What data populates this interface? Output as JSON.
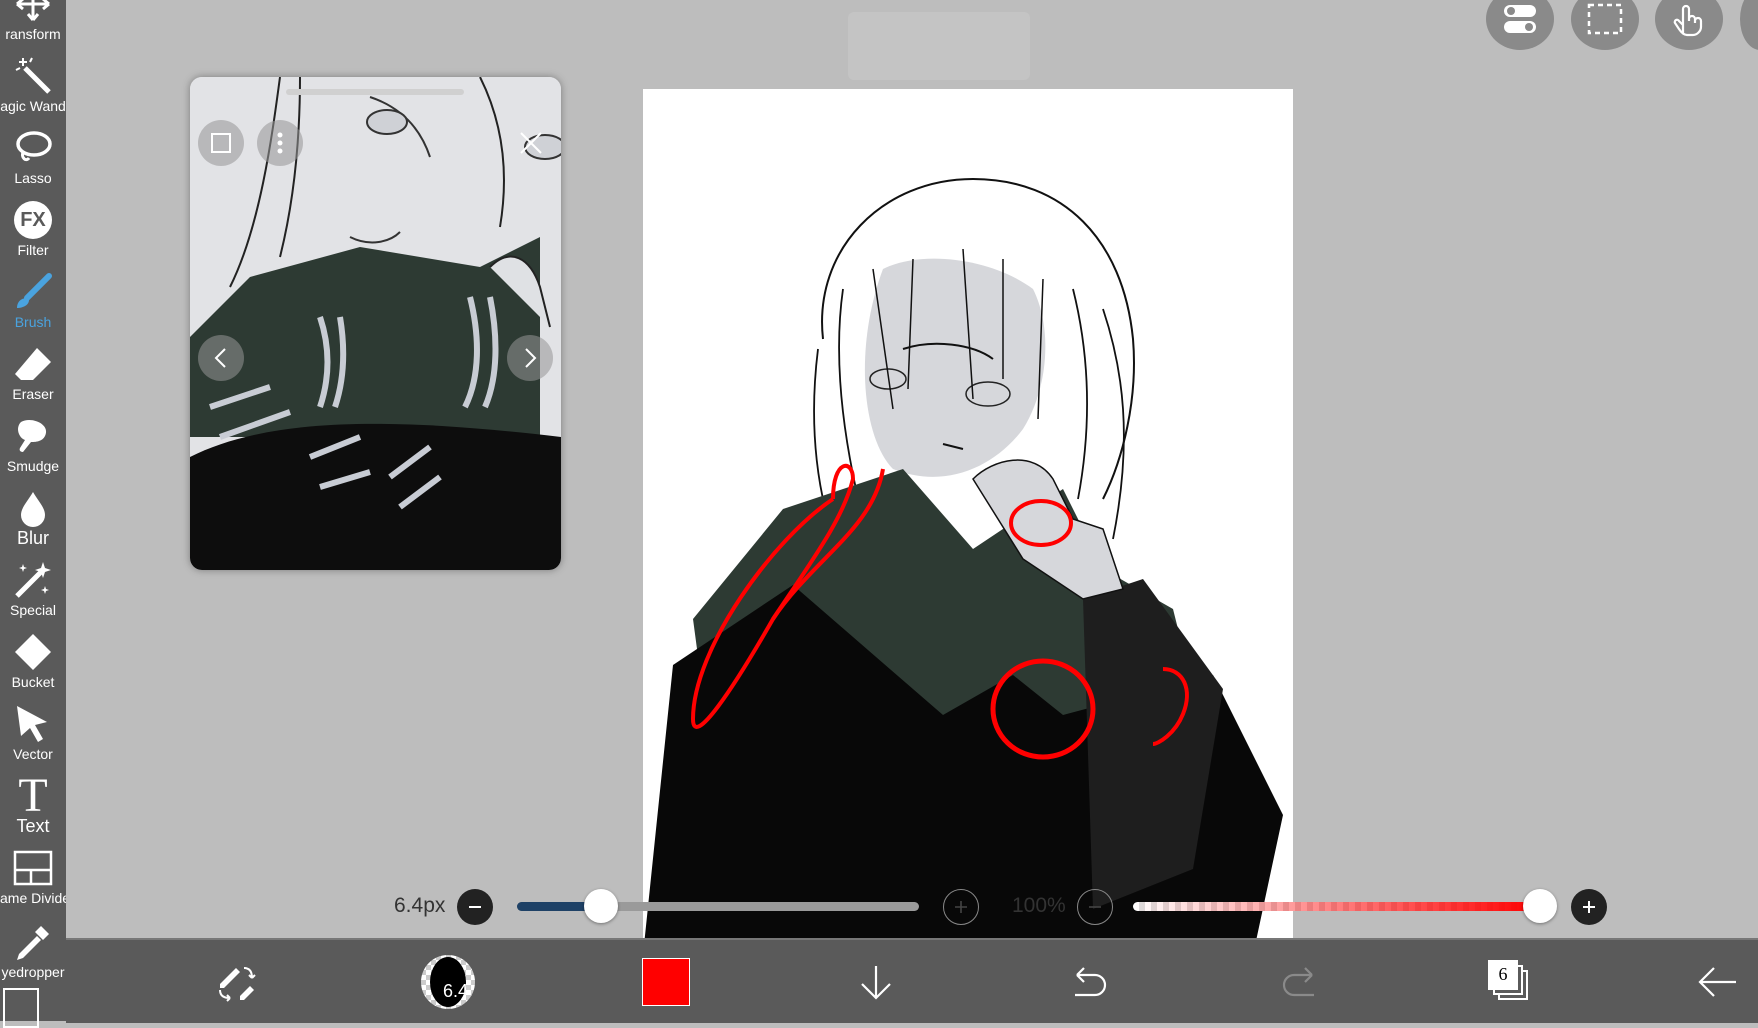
{
  "sidebar": {
    "tools": [
      {
        "label": "ransform",
        "icon": "transform-icon"
      },
      {
        "label": "agic Wand",
        "icon": "magic-wand-icon"
      },
      {
        "label": "Lasso",
        "icon": "lasso-icon"
      },
      {
        "label": "Filter",
        "icon": "fx-filter-icon",
        "glyph": "FX"
      },
      {
        "label": "Brush",
        "icon": "brush-icon",
        "active": true
      },
      {
        "label": "Eraser",
        "icon": "eraser-icon"
      },
      {
        "label": "Smudge",
        "icon": "smudge-icon"
      },
      {
        "label": "Blur",
        "icon": "blur-drop-icon"
      },
      {
        "label": "Special",
        "icon": "special-pen-icon"
      },
      {
        "label": "Bucket",
        "icon": "bucket-icon"
      },
      {
        "label": "Vector",
        "icon": "vector-cursor-icon"
      },
      {
        "label": "Text",
        "icon": "text-icon",
        "glyph": "T"
      },
      {
        "label": "ame Divider",
        "icon": "frame-divider-icon"
      },
      {
        "label": "yedropper",
        "icon": "eyedropper-icon"
      }
    ],
    "active_color": "#4aa3df"
  },
  "brush_size": {
    "value": "6.4px",
    "fraction": 0.21
  },
  "opacity": {
    "value": "100%",
    "fraction": 1.0
  },
  "bottom": {
    "brush_preview_size": "6.4",
    "current_color": "#ff0000",
    "layer_count": "6"
  },
  "colors": {
    "ui_dark": "#5a5a5a",
    "ui_background": "#bdbdbd",
    "slider_fill": "#1e4166",
    "opacity_red": "#ff0000"
  }
}
